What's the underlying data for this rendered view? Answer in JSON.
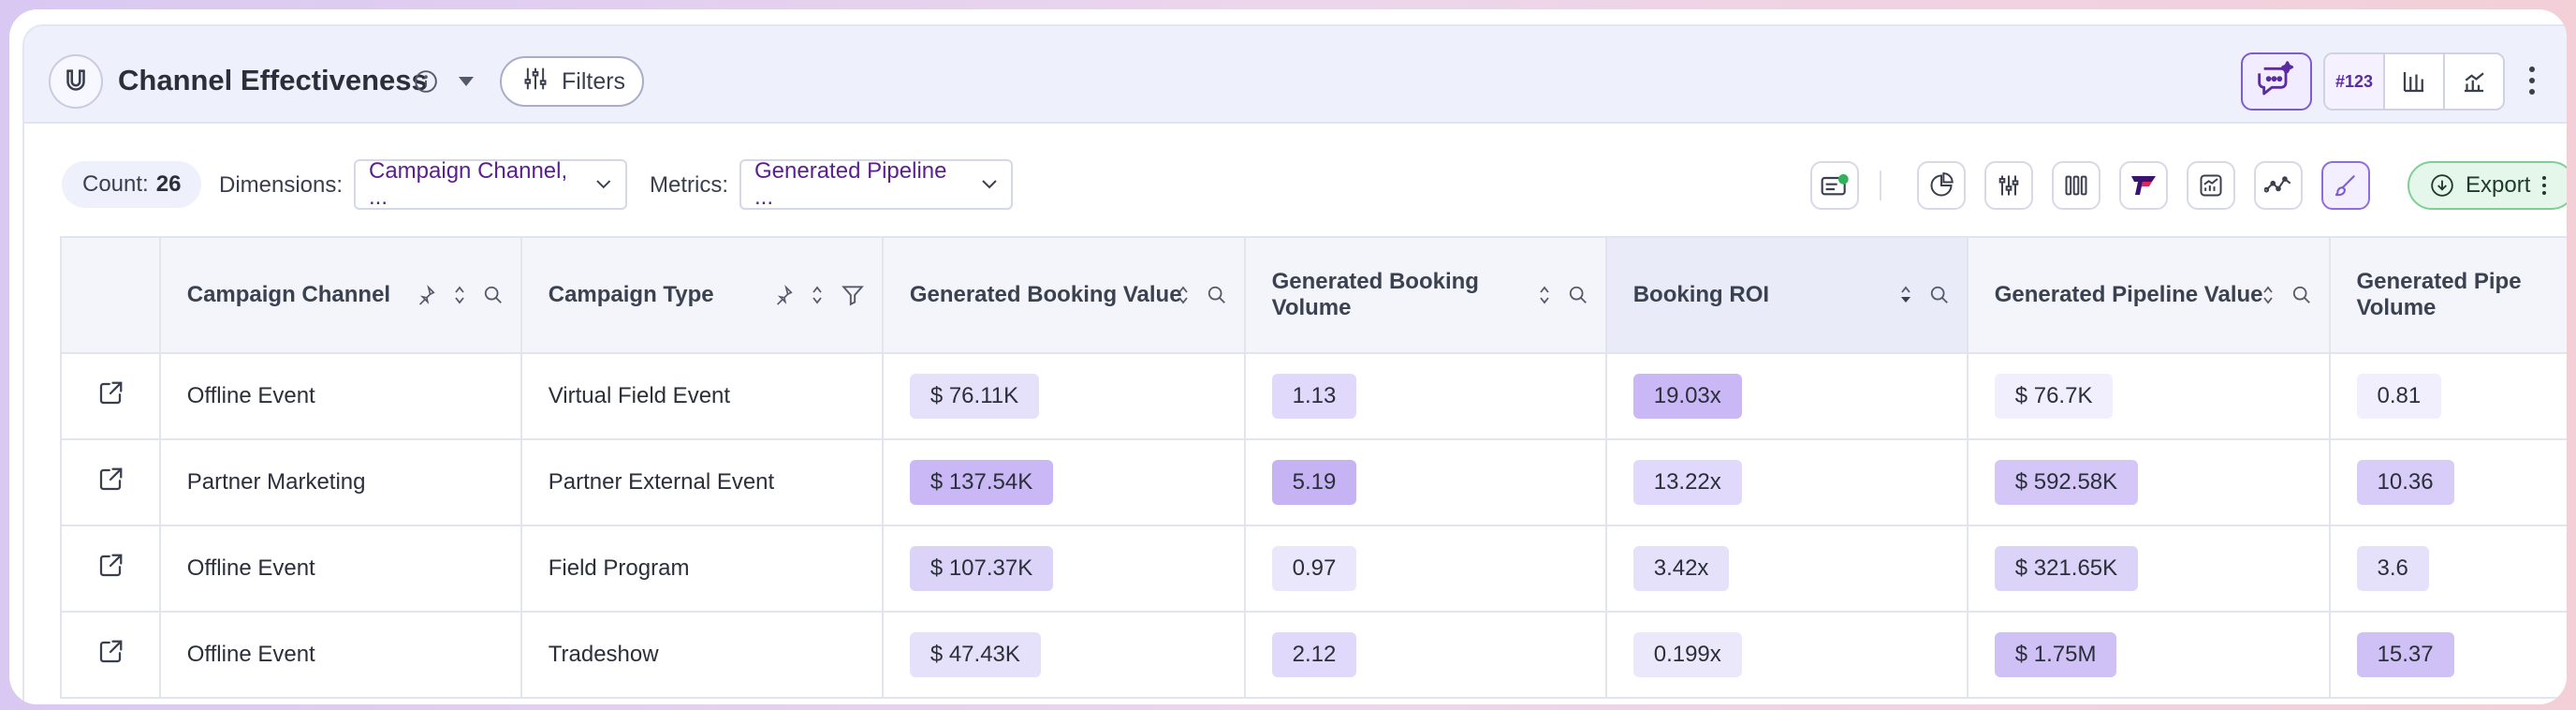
{
  "header": {
    "title": "Channel Effectiveness",
    "filters_label": "Filters",
    "view_number_label": "#123",
    "colors": {
      "accent": "#7b5bd6",
      "header_bg": "#eef0fb"
    }
  },
  "toolbar": {
    "count_label": "Count:",
    "count_value": "26",
    "dimensions_label": "Dimensions:",
    "dimensions_value": "Campaign Channel, ...",
    "metrics_label": "Metrics:",
    "metrics_value": "Generated Pipeline ...",
    "export_label": "Export",
    "tools": [
      "table-status-icon",
      "pie-chart-icon",
      "sliders-icon",
      "columns-icon",
      "funnel-logo-icon",
      "trend-chart-icon",
      "line-chart-icon",
      "brush-icon"
    ]
  },
  "table": {
    "columns": [
      {
        "label": ""
      },
      {
        "label": "Campaign Channel"
      },
      {
        "label": "Campaign Type"
      },
      {
        "label": "Generated Booking Value"
      },
      {
        "label": "Generated Booking Volume"
      },
      {
        "label": "Booking ROI"
      },
      {
        "label": "Generated Pipeline Value"
      },
      {
        "label": "Generated Pipe Volume"
      }
    ],
    "rows": [
      {
        "channel": "Offline Event",
        "type": "Virtual Field Event",
        "booking_value": "$ 76.11K",
        "booking_volume": "1.13",
        "booking_roi": "19.03x",
        "pipeline_value": "$ 76.7K",
        "pipeline_volume": "0.81"
      },
      {
        "channel": "Partner Marketing",
        "type": "Partner External Event",
        "booking_value": "$ 137.54K",
        "booking_volume": "5.19",
        "booking_roi": "13.22x",
        "pipeline_value": "$ 592.58K",
        "pipeline_volume": "10.36"
      },
      {
        "channel": "Offline Event",
        "type": "Field Program",
        "booking_value": "$ 107.37K",
        "booking_volume": "0.97",
        "booking_roi": "3.42x",
        "pipeline_value": "$ 321.65K",
        "pipeline_volume": "3.6"
      },
      {
        "channel": "Offline Event",
        "type": "Tradeshow",
        "booking_value": "$ 47.43K",
        "booking_volume": "2.12",
        "booking_roi": "0.199x",
        "pipeline_value": "$ 1.75M",
        "pipeline_volume": "15.37"
      }
    ]
  }
}
